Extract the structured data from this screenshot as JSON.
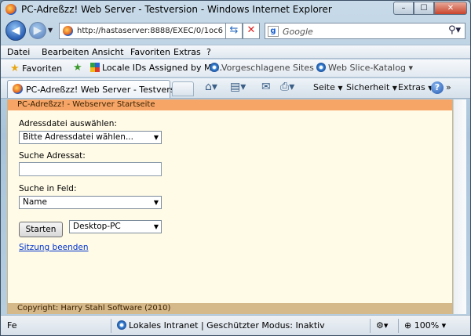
{
  "window": {
    "title": "PC-Adreßzz! Web Server - Testversion - Windows Internet Explorer",
    "controls": {
      "minimize": "–",
      "maximize": "☐",
      "close": "✕"
    }
  },
  "navigation": {
    "address": "http://hastaserver:8888/EXEC/0/1oc6",
    "search_placeholder": "Google"
  },
  "menu": [
    "Datei",
    "Bearbeiten",
    "Ansicht",
    "Favoriten",
    "Extras",
    "?"
  ],
  "favorites_bar": {
    "favorites_label": "Favoriten",
    "items": [
      "Locale IDs Assigned by Mi...",
      "Vorgeschlagene Sites",
      "Web Slice-Katalog"
    ]
  },
  "tabs": {
    "active_tab": "PC-Adreßzz! Web Server - Testversion"
  },
  "command_bar": {
    "page": "Seite",
    "security": "Sicherheit",
    "extras": "Extras",
    "help": "?"
  },
  "page": {
    "header": "PC-Adreßzz! - Webserver Startseite",
    "file_label": "Adressdatei auswählen:",
    "file_select": "Bitte Adressdatei wählen...",
    "search_label": "Suche Adressat:",
    "search_value": "",
    "field_label": "Suche in Feld:",
    "field_select": "Name",
    "start_button": "Starten",
    "target_select": "Desktop-PC",
    "logout_link": "Sitzung beenden",
    "footer": "Copyright: Harry Stahl Software (2010)"
  },
  "status_bar": {
    "left": "Fe",
    "zone": "Lokales Intranet | Geschützter Modus: Inaktiv",
    "zoom": "100%"
  }
}
